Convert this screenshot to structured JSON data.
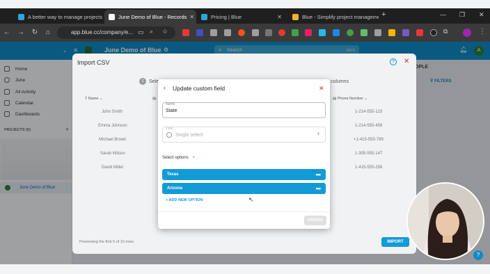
{
  "browser": {
    "tabs": [
      {
        "title": "A better way to manage projects",
        "favicon_color": "#2aa5e0"
      },
      {
        "title": "June Demo of Blue - Records",
        "favicon_color": "#ffffff",
        "active": true
      },
      {
        "title": "Pricing | Blue",
        "favicon_color": "#2aa5e0"
      },
      {
        "title": "Blue - Simplify project management",
        "favicon_color": "#f0b429"
      }
    ],
    "new_tab": "+",
    "url": "app.blue.cc/company/e..."
  },
  "app": {
    "workspace_title": "June Demo of Blue",
    "search_placeholder": "Search",
    "search_shortcut": "Ctrl K",
    "avatar_initial": "A",
    "sidebar": {
      "items": [
        {
          "label": "Home"
        },
        {
          "label": "June"
        },
        {
          "label": "All Activity"
        },
        {
          "label": "Calendar"
        },
        {
          "label": "Dashboards"
        }
      ],
      "projects_header": "PROJECTS (5)",
      "active_project": "June Demo of Blue"
    },
    "bg_right_label": "OPLE",
    "filters_label": "FILTERS"
  },
  "import_csv": {
    "title": "Import CSV",
    "step_number": "1",
    "step_partial": "Sele",
    "columns_partial": "columns",
    "name_col": "Name",
    "phone_col": "Phone Number",
    "names": [
      "John Smith",
      "Emma Johnson",
      "Michael Brown",
      "Sarah Wilson",
      "David Miller"
    ],
    "phones": [
      "1-214-555-123",
      "1-214-555-456",
      "+1-415-555-789",
      "1-305-555-147",
      "1-415-555-258"
    ],
    "footer": "Previewing the first 5 of 10 rows",
    "import_button": "IMPORT"
  },
  "modal": {
    "title": "Update custom field",
    "name_label": "Name",
    "name_value": "State",
    "type_label": "Type",
    "type_placeholder": "Single select",
    "select_options_label": "Select options",
    "options": [
      {
        "label": "Texas"
      },
      {
        "label": "Arizona"
      }
    ],
    "add_option_label": "ADD NEW OPTION",
    "update_button": "UPDATE"
  },
  "colors": {
    "brand": "#0f8bc6",
    "option_bg": "#149ad5",
    "close_red": "#d32f2f"
  }
}
